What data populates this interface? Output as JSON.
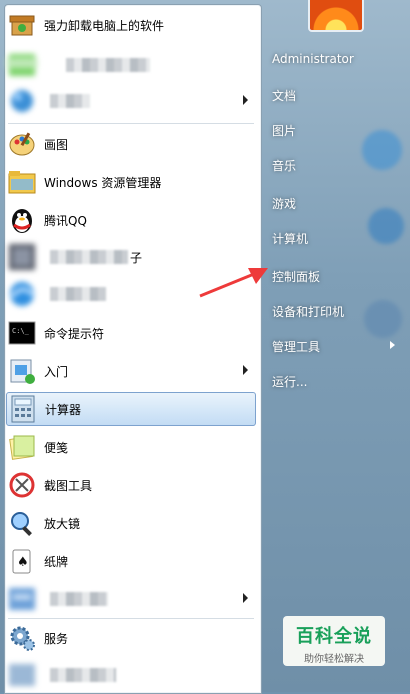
{
  "programs": [
    {
      "label": "强力卸载电脑上的软件",
      "icon": "uninstall-box-icon"
    },
    {
      "label": "",
      "icon": "blurred-app-icon",
      "blurred": true
    },
    {
      "label": "",
      "icon": "blurred-app-icon",
      "blurred": true,
      "submenu": true
    },
    {
      "label": "画图",
      "icon": "paint-palette-icon"
    },
    {
      "label": "Windows 资源管理器",
      "icon": "folder-explorer-icon"
    },
    {
      "label": "腾讯QQ",
      "icon": "qq-penguin-icon"
    },
    {
      "label": "子",
      "icon": "blurred-app-icon",
      "blurred": true
    },
    {
      "label": "",
      "icon": "blurred-app-icon",
      "blurred": true
    },
    {
      "label": "命令提示符",
      "icon": "cmd-terminal-icon"
    },
    {
      "label": "入门",
      "icon": "getting-started-icon",
      "submenu": true
    },
    {
      "label": "计算器",
      "icon": "calculator-icon",
      "selected": true
    },
    {
      "label": "便笺",
      "icon": "sticky-notes-icon"
    },
    {
      "label": "截图工具",
      "icon": "snipping-tool-icon"
    },
    {
      "label": "放大镜",
      "icon": "magnifier-icon"
    },
    {
      "label": "纸牌",
      "icon": "solitaire-cards-icon"
    },
    {
      "label": "",
      "icon": "blurred-app-icon",
      "blurred": true,
      "submenu": true
    },
    {
      "label": "服务",
      "icon": "services-gear-icon"
    },
    {
      "label": "",
      "icon": "blurred-app-icon",
      "blurred": true
    }
  ],
  "right_links": [
    {
      "label": "Administrator"
    },
    {
      "label": "文档"
    },
    {
      "label": "图片"
    },
    {
      "label": "音乐"
    },
    {
      "label": "游戏"
    },
    {
      "label": "计算机"
    },
    {
      "label": "控制面板"
    },
    {
      "label": "设备和打印机"
    },
    {
      "label": "管理工具",
      "submenu": true
    },
    {
      "label": "运行..."
    }
  ],
  "watermark": {
    "title": "百科全说",
    "subtitle": "助你轻松解决"
  },
  "colors": {
    "accent": "#7da2ce",
    "annotation_arrow": "#ee3a3a",
    "watermark_green": "#19a05a"
  }
}
